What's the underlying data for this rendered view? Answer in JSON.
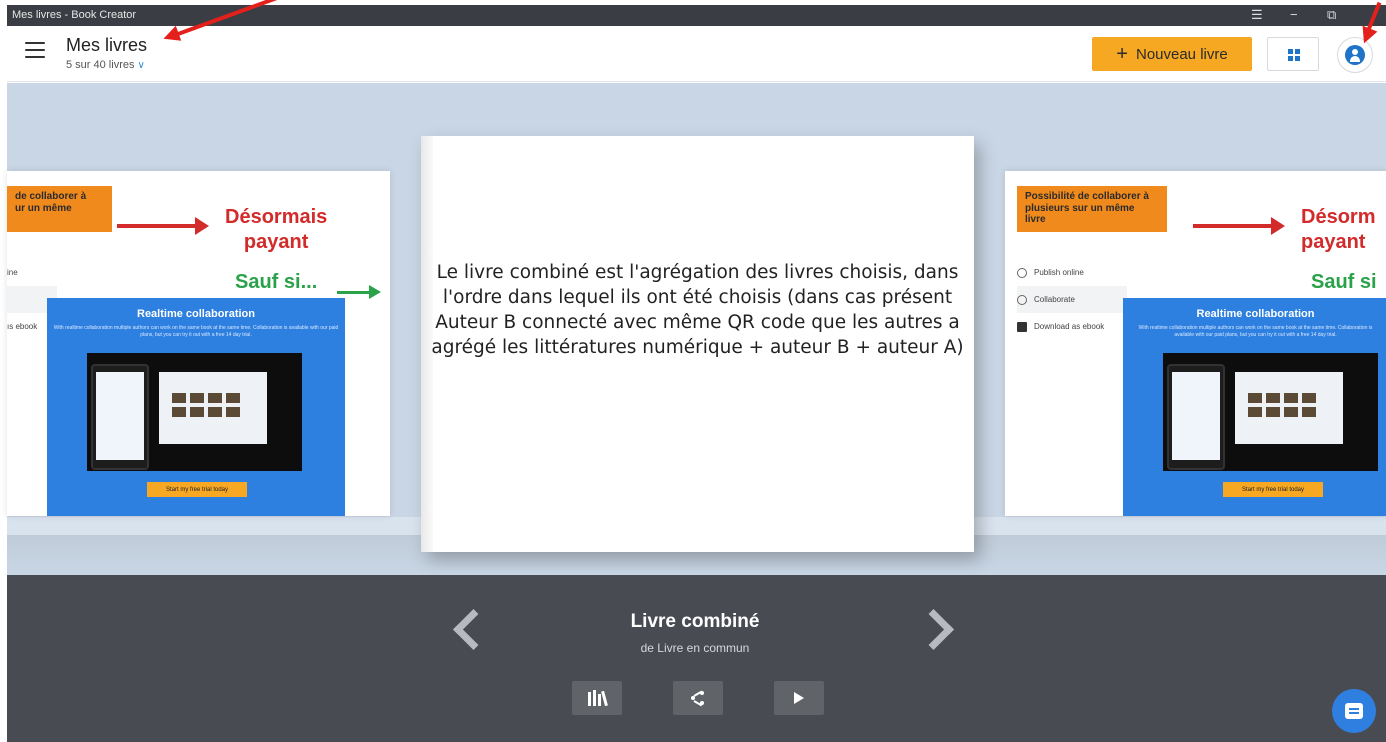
{
  "window": {
    "title": "Mes livres - Book Creator",
    "controls": [
      "☰",
      "−",
      "⧉",
      "✕"
    ]
  },
  "header": {
    "title": "Mes livres",
    "subtitle": "5 sur 40 livres",
    "new_button": "Nouveau livre"
  },
  "left_book": {
    "orange_text": "de collaborer à\nur un même",
    "red_text": "Désormais\npayant",
    "green_text": "Sauf si...",
    "menu": [
      "ine",
      "",
      "ıs ebook"
    ]
  },
  "right_book": {
    "orange_text": "Possibilité de collaborer à\nplusieurs sur un même\nlivre",
    "red_text": "Désorm\npayant",
    "green_text": "Sauf si",
    "menu": [
      "Publish online",
      "Collaborate",
      "Download as ebook"
    ]
  },
  "promo": {
    "heading": "Realtime collaboration",
    "text": "With realtime collaboration multiple authors can work on the same book at the same time. Collaboration is available with our paid plans, but you can try it out with a free 14 day trial.",
    "cta": "Start my free trial today"
  },
  "center_book": {
    "text": "Le livre combiné est l'agrégation des livres choisis, dans l'ordre dans lequel ils ont été choisis (dans cas présent Auteur B connecté avec même QR code que les autres a agrégé les littératures numérique + auteur B + auteur A)"
  },
  "current_book": {
    "title": "Livre combiné",
    "author": "de Livre en commun"
  },
  "colors": {
    "accent": "#f7a823",
    "brand_blue": "#1f73c9",
    "annotation_red": "#e3201b"
  },
  "icons": [
    "menu-icon",
    "chevron-down-icon",
    "plus-icon",
    "grid-view-icon",
    "user-icon",
    "chevron-left-icon",
    "chevron-right-icon",
    "library-icon",
    "share-icon",
    "play-icon",
    "chat-icon"
  ]
}
